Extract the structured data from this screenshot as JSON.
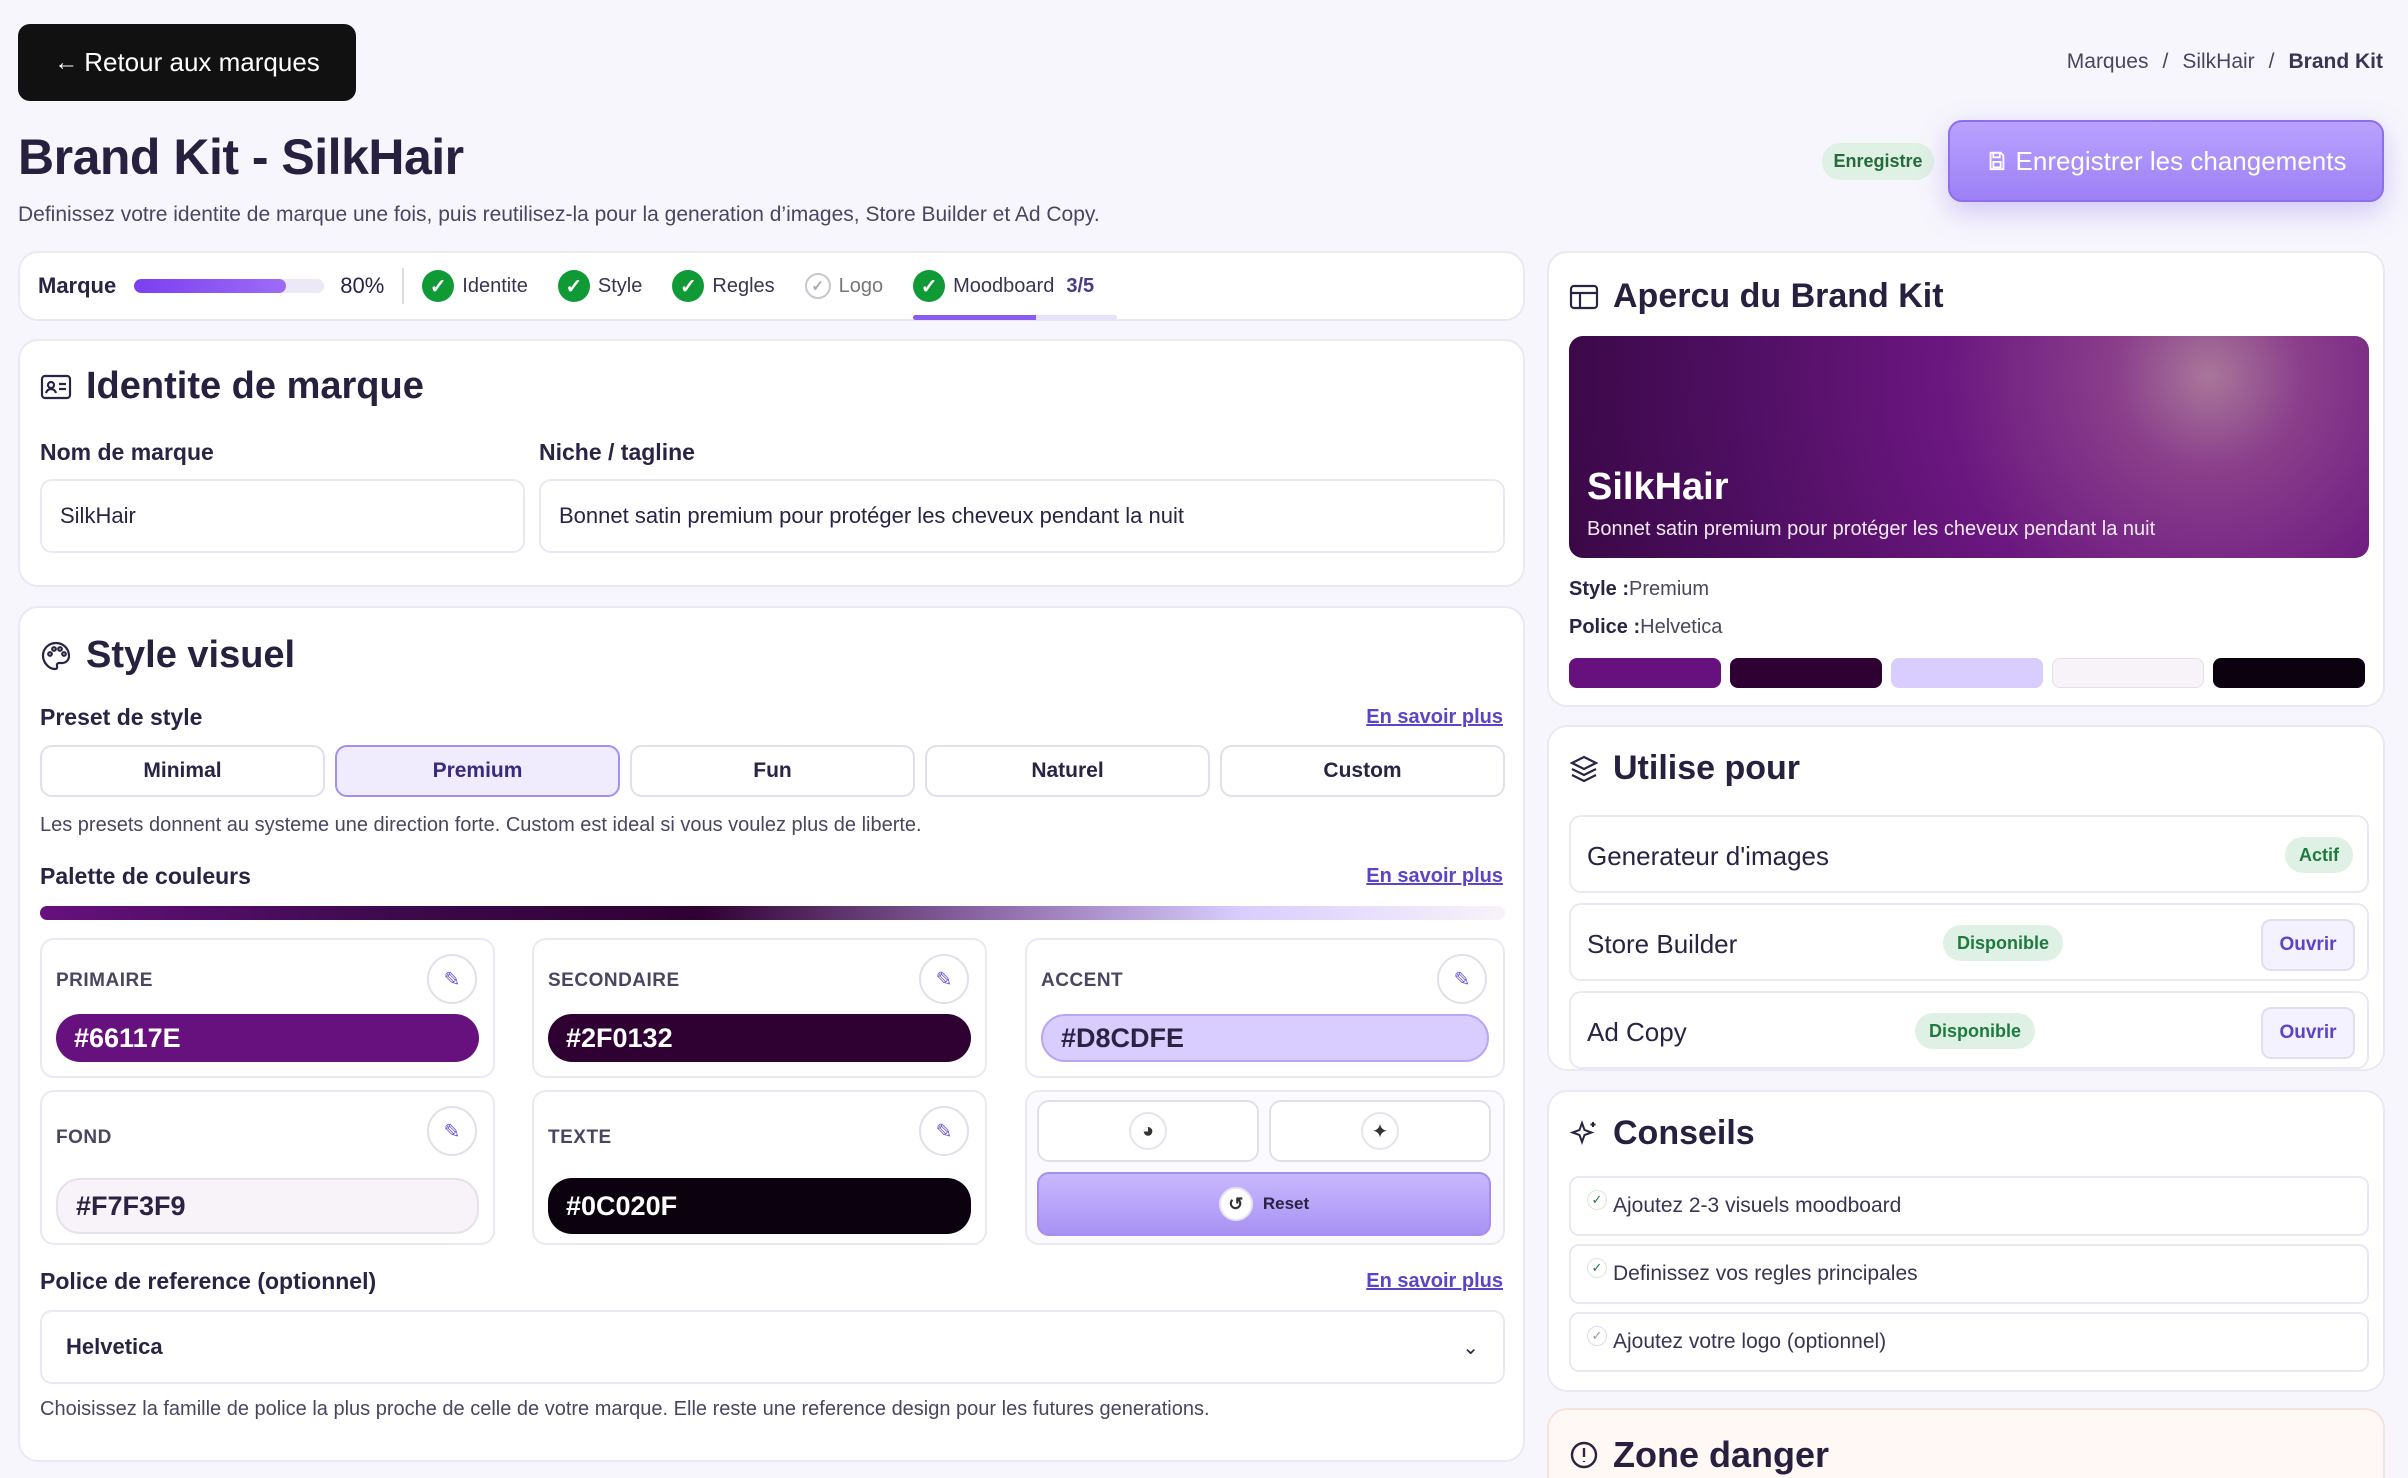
{
  "header": {
    "back_label": "Retour aux marques",
    "breadcrumb": [
      "Marques",
      "/",
      "SilkHair",
      "/",
      "Brand Kit"
    ],
    "title": "Brand Kit - SilkHair",
    "subtitle": "Definissez votre identite de marque une fois, puis reutilisez-la pour la generation d’images, Store Builder et Ad Copy.",
    "saved_badge": "Enregistre",
    "save_label": "Enregistrer les changements"
  },
  "progress": {
    "label": "Marque",
    "percent_text": "80%",
    "percent": 0.8,
    "steps": [
      {
        "label": "Identite",
        "done": true
      },
      {
        "label": "Style",
        "done": true
      },
      {
        "label": "Regles",
        "done": true
      },
      {
        "label": "Logo",
        "done": false
      },
      {
        "label": "Moodboard",
        "done": true,
        "count": "3/5",
        "fraction": 0.6
      }
    ]
  },
  "identity": {
    "title": "Identite de marque",
    "name_label": "Nom de marque",
    "name_value": "SilkHair",
    "niche_label": "Niche / tagline",
    "niche_value": "Bonnet satin premium pour protéger les cheveux pendant la nuit"
  },
  "style": {
    "title": "Style visuel",
    "preset_label": "Preset de style",
    "learn_more": "En savoir plus",
    "presets": [
      "Minimal",
      "Premium",
      "Fun",
      "Naturel",
      "Custom"
    ],
    "selected_preset": "Premium",
    "preset_help": "Les presets donnent au systeme une direction forte. Custom est ideal si vous voulez plus de liberte.",
    "palette_label": "Palette de couleurs",
    "palette": [
      {
        "label": "PRIMAIRE",
        "hex": "#66117E",
        "text_color": "#ffffff"
      },
      {
        "label": "SECONDAIRE",
        "hex": "#2F0132",
        "text_color": "#ffffff"
      },
      {
        "label": "ACCENT",
        "hex": "#D8CDFE",
        "text_color": "#2a2344"
      },
      {
        "label": "FOND",
        "hex": "#F7F3F9",
        "text_color": "#2a2344"
      },
      {
        "label": "TEXTE",
        "hex": "#0C020F",
        "text_color": "#ffffff"
      }
    ],
    "reset_label": "Reset",
    "font_label": "Police de reference (optionnel)",
    "font_value": "Helvetica",
    "font_help": "Choisissez la famille de police la plus proche de celle de votre marque. Elle reste une reference design pour les futures generations."
  },
  "preview": {
    "title": "Apercu du Brand Kit",
    "hero_title": "SilkHair",
    "hero_sub": "Bonnet satin premium pour protéger les cheveux pendant la nuit",
    "style_key": "Style :",
    "style_val": "Premium",
    "font_key": "Police :",
    "font_val": "Helvetica",
    "colors": [
      "#66117E",
      "#2F0132",
      "#D8CDFE",
      "#F7F3F9",
      "#0C020F"
    ]
  },
  "uses": {
    "title": "Utilise pour",
    "items": [
      {
        "name": "Generateur d'images",
        "badge": "Actif"
      },
      {
        "name": "Store Builder",
        "badge": "Disponible",
        "action": "Ouvrir"
      },
      {
        "name": "Ad Copy",
        "badge": "Disponible",
        "action": "Ouvrir"
      }
    ]
  },
  "tips": {
    "title": "Conseils",
    "items": [
      {
        "text": "Ajoutez 2-3 visuels moodboard",
        "done": true
      },
      {
        "text": "Definissez vos regles principales",
        "done": true
      },
      {
        "text": "Ajoutez votre logo (optionnel)",
        "done": false
      }
    ]
  },
  "danger": {
    "title": "Zone danger"
  },
  "colors": {
    "accent": "#9d80f5",
    "success": "#0f9a36",
    "link": "#5b44c8"
  }
}
